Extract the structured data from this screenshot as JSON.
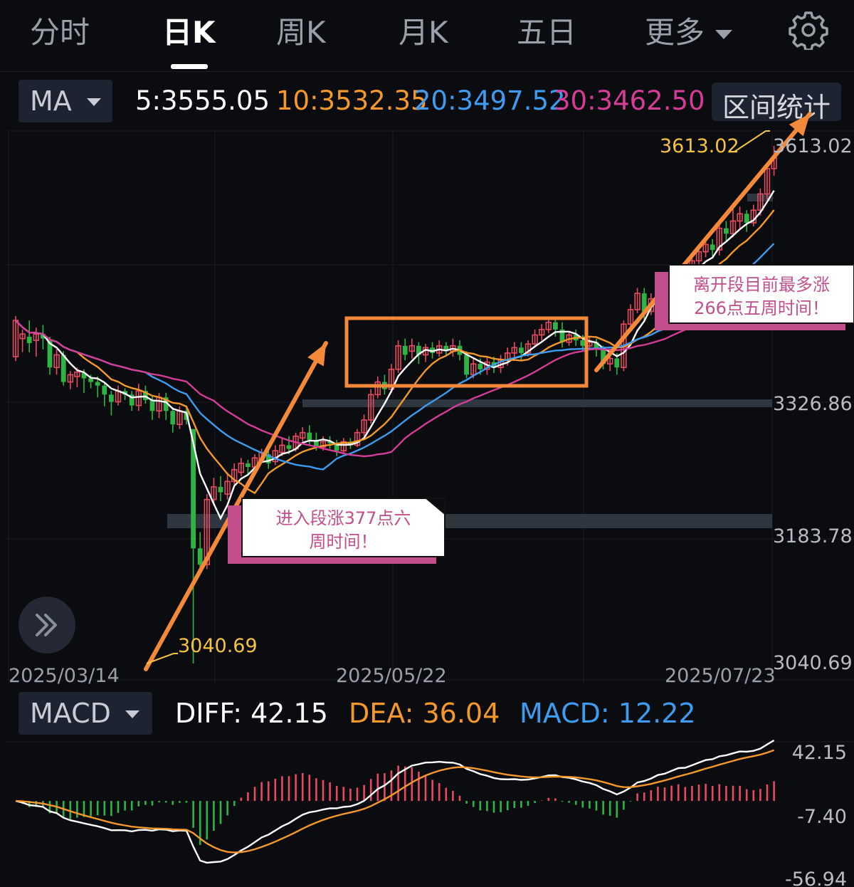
{
  "tabs": [
    {
      "label": "分时",
      "active": false
    },
    {
      "label": "日K",
      "active": true
    },
    {
      "label": "周K",
      "active": false
    },
    {
      "label": "月K",
      "active": false
    },
    {
      "label": "五日",
      "active": false
    },
    {
      "label": "更多",
      "active": false
    }
  ],
  "ma_indicator": {
    "label": "MA"
  },
  "ma_values": [
    {
      "text": "5:3555.05",
      "color": "#ffffff"
    },
    {
      "text": "10:3532.35",
      "color": "#f5982c"
    },
    {
      "text": "20:3497.52",
      "color": "#3d9cf0"
    },
    {
      "text": "30:3462.50",
      "color": "#d43c96"
    }
  ],
  "range_button": {
    "label": "区间统计"
  },
  "macd_indicator": {
    "label": "MACD"
  },
  "macd_values": [
    {
      "text": "DIFF: 42.15",
      "color": "#ffffff"
    },
    {
      "text": "DEA: 36.04",
      "color": "#f5982c"
    },
    {
      "text": "MACD: 12.22",
      "color": "#3d9cf0"
    }
  ],
  "colors": {
    "up": "#e84a5f",
    "down": "#2fb344",
    "annotation_arrow": "#f5893a",
    "label_yellow": "#f5c242"
  },
  "chart_data": {
    "type": "candlestick",
    "price_axis": {
      "ticks": [
        "3613.02",
        "3326.86",
        "3183.78",
        "3040.69"
      ],
      "ylim": [
        3040.69,
        3613.02
      ]
    },
    "date_labels": [
      "2025/03/14",
      "2025/05/22",
      "2025/07/23"
    ],
    "high_label": "3613.02",
    "low_label": "3040.69",
    "candles": [
      [
        3380,
        3420,
        3375,
        3425
      ],
      [
        3400,
        3405,
        3385,
        3410
      ],
      [
        3402,
        3395,
        3385,
        3420
      ],
      [
        3398,
        3405,
        3380,
        3412
      ],
      [
        3405,
        3400,
        3388,
        3415
      ],
      [
        3398,
        3368,
        3360,
        3402
      ],
      [
        3368,
        3382,
        3360,
        3388
      ],
      [
        3382,
        3352,
        3348,
        3386
      ],
      [
        3352,
        3360,
        3344,
        3364
      ],
      [
        3358,
        3363,
        3346,
        3368
      ],
      [
        3362,
        3356,
        3340,
        3366
      ],
      [
        3356,
        3352,
        3345,
        3360
      ],
      [
        3352,
        3348,
        3335,
        3358
      ],
      [
        3348,
        3338,
        3325,
        3352
      ],
      [
        3338,
        3330,
        3315,
        3342
      ],
      [
        3330,
        3342,
        3326,
        3348
      ],
      [
        3342,
        3338,
        3332,
        3345
      ],
      [
        3338,
        3326,
        3320,
        3342
      ],
      [
        3326,
        3342,
        3320,
        3350
      ],
      [
        3342,
        3332,
        3328,
        3348
      ],
      [
        3332,
        3320,
        3310,
        3336
      ],
      [
        3320,
        3335,
        3312,
        3340
      ],
      [
        3335,
        3320,
        3310,
        3340
      ],
      [
        3320,
        3305,
        3296,
        3324
      ],
      [
        3305,
        3320,
        3300,
        3325
      ],
      [
        3320,
        3310,
        3305,
        3325
      ],
      [
        3300,
        3168,
        3040.69,
        3240
      ],
      [
        3168,
        3150,
        3140,
        3186
      ],
      [
        3150,
        3222,
        3145,
        3228
      ],
      [
        3222,
        3236,
        3218,
        3246
      ],
      [
        3236,
        3230,
        3220,
        3248
      ],
      [
        3228,
        3242,
        3222,
        3252
      ],
      [
        3242,
        3255,
        3236,
        3262
      ],
      [
        3252,
        3262,
        3248,
        3268
      ],
      [
        3262,
        3258,
        3250,
        3266
      ],
      [
        3258,
        3268,
        3254,
        3272
      ],
      [
        3266,
        3274,
        3262,
        3278
      ],
      [
        3272,
        3262,
        3256,
        3278
      ],
      [
        3264,
        3276,
        3260,
        3282
      ],
      [
        3274,
        3282,
        3270,
        3290
      ],
      [
        3282,
        3278,
        3272,
        3292
      ],
      [
        3278,
        3292,
        3275,
        3296
      ],
      [
        3290,
        3296,
        3286,
        3302
      ],
      [
        3296,
        3288,
        3282,
        3304
      ],
      [
        3288,
        3280,
        3276,
        3296
      ],
      [
        3280,
        3286,
        3276,
        3292
      ],
      [
        3286,
        3284,
        3278,
        3292
      ],
      [
        3284,
        3276,
        3270,
        3288
      ],
      [
        3276,
        3286,
        3272,
        3290
      ],
      [
        3286,
        3282,
        3278,
        3290
      ],
      [
        3282,
        3296,
        3280,
        3300
      ],
      [
        3296,
        3310,
        3292,
        3316
      ],
      [
        3310,
        3338,
        3306,
        3344
      ],
      [
        3338,
        3352,
        3334,
        3358
      ],
      [
        3352,
        3344,
        3338,
        3360
      ],
      [
        3344,
        3366,
        3340,
        3372
      ],
      [
        3366,
        3392,
        3362,
        3398
      ],
      [
        3392,
        3382,
        3376,
        3400
      ],
      [
        3386,
        3392,
        3378,
        3400
      ],
      [
        3392,
        3382,
        3372,
        3396
      ],
      [
        3382,
        3390,
        3374,
        3394
      ],
      [
        3390,
        3384,
        3378,
        3396
      ],
      [
        3384,
        3392,
        3380,
        3398
      ],
      [
        3392,
        3386,
        3380,
        3396
      ],
      [
        3386,
        3392,
        3380,
        3400
      ],
      [
        3392,
        3382,
        3376,
        3398
      ],
      [
        3382,
        3360,
        3356,
        3386
      ],
      [
        3360,
        3372,
        3356,
        3378
      ],
      [
        3372,
        3366,
        3360,
        3378
      ],
      [
        3366,
        3374,
        3360,
        3380
      ],
      [
        3374,
        3368,
        3362,
        3380
      ],
      [
        3368,
        3376,
        3362,
        3382
      ],
      [
        3376,
        3384,
        3370,
        3390
      ],
      [
        3384,
        3390,
        3378,
        3396
      ],
      [
        3390,
        3384,
        3376,
        3396
      ],
      [
        3384,
        3394,
        3380,
        3398
      ],
      [
        3394,
        3404,
        3390,
        3410
      ],
      [
        3404,
        3410,
        3398,
        3416
      ],
      [
        3410,
        3418,
        3406,
        3424
      ],
      [
        3418,
        3410,
        3402,
        3424
      ],
      [
        3410,
        3396,
        3390,
        3418
      ],
      [
        3396,
        3404,
        3392,
        3408
      ],
      [
        3404,
        3398,
        3392,
        3410
      ],
      [
        3398,
        3392,
        3386,
        3404
      ],
      [
        3392,
        3396,
        3388,
        3402
      ],
      [
        3396,
        3388,
        3380,
        3400
      ],
      [
        3388,
        3372,
        3366,
        3392
      ],
      [
        3372,
        3378,
        3364,
        3384
      ],
      [
        3378,
        3368,
        3360,
        3384
      ],
      [
        3368,
        3416,
        3364,
        3420
      ],
      [
        3416,
        3432,
        3412,
        3438
      ],
      [
        3432,
        3450,
        3428,
        3456
      ],
      [
        3450,
        3430,
        3420,
        3456
      ],
      [
        3430,
        3444,
        3426,
        3450
      ],
      [
        3444,
        3460,
        3438,
        3466
      ],
      [
        3460,
        3450,
        3442,
        3464
      ],
      [
        3450,
        3468,
        3444,
        3474
      ],
      [
        3468,
        3476,
        3462,
        3482
      ],
      [
        3476,
        3464,
        3456,
        3480
      ],
      [
        3464,
        3486,
        3460,
        3492
      ],
      [
        3486,
        3496,
        3480,
        3504
      ],
      [
        3496,
        3504,
        3490,
        3512
      ],
      [
        3504,
        3498,
        3490,
        3510
      ],
      [
        3498,
        3522,
        3492,
        3528
      ],
      [
        3522,
        3516,
        3508,
        3530
      ],
      [
        3516,
        3530,
        3512,
        3550
      ],
      [
        3530,
        3538,
        3522,
        3546
      ],
      [
        3538,
        3528,
        3518,
        3542
      ],
      [
        3528,
        3542,
        3524,
        3548
      ],
      [
        3542,
        3560,
        3536,
        3566
      ],
      [
        3560,
        3588,
        3554,
        3592
      ],
      [
        3588,
        3600,
        3580,
        3613.02
      ]
    ],
    "ma_series": [
      {
        "name": "5",
        "color": "#ffffff"
      },
      {
        "name": "10",
        "color": "#f5982c"
      },
      {
        "name": "20",
        "color": "#3d9cf0"
      },
      {
        "name": "30",
        "color": "#d43c96"
      }
    ],
    "macd_axis": {
      "ticks": [
        "42.15",
        "-7.40",
        "-56.94"
      ],
      "ylim": [
        -56.94,
        42.15
      ]
    },
    "macd": {
      "diff_last": 42.15,
      "dea_last": 36.04,
      "macd_last": 12.22
    }
  },
  "annotations": [
    {
      "text_lines": [
        "进入段涨377点六",
        "周时间！"
      ],
      "color": "#c34e8c"
    },
    {
      "text_lines": [
        "离开段目前最多涨",
        "266点五周时间！"
      ],
      "color": "#c34e8c"
    }
  ]
}
